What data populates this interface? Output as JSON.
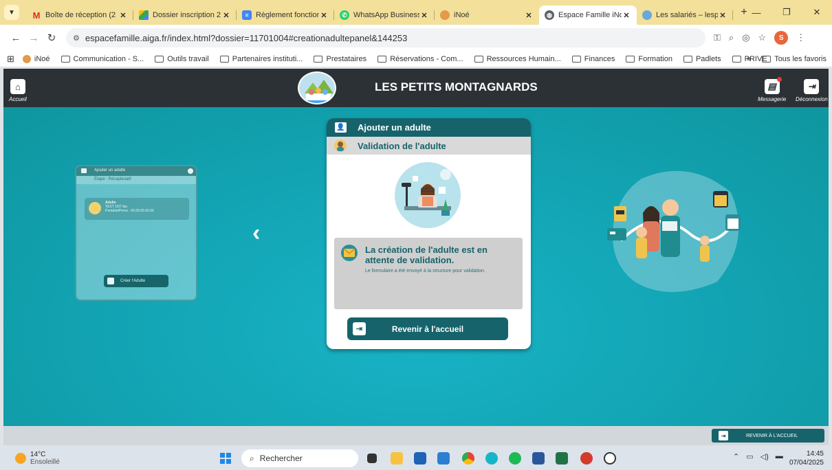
{
  "browser": {
    "tabs": [
      {
        "label": "Boîte de réception (2",
        "icon": "gmail-icon",
        "color": "#d93025",
        "active": false
      },
      {
        "label": "Dossier inscription 2",
        "icon": "drive-icon",
        "color": "#1e8e3e",
        "active": false
      },
      {
        "label": "Règlement fonction",
        "icon": "docs-icon",
        "color": "#4285f4",
        "active": false
      },
      {
        "label": "WhatsApp Business",
        "icon": "whatsapp-icon",
        "color": "#25d366",
        "active": false
      },
      {
        "label": "iNoé",
        "icon": "inoe-icon",
        "color": "#e39a4a",
        "active": false
      },
      {
        "label": "Espace Famille iNoe",
        "icon": "globe-icon",
        "color": "#5f6368",
        "active": true
      },
      {
        "label": "Les salariés – lespeti",
        "icon": "site-icon",
        "color": "#6aa9d8",
        "active": false
      }
    ],
    "url": "espacefamille.aiga.fr/index.html?dossier=11701004#creationadultepanel&144253",
    "bookmarks": [
      "iNoé",
      "Communication - S...",
      "Outils travail",
      "Partenaires instituti...",
      "Prestataires",
      "Réservations - Com...",
      "Ressources Humain...",
      "Finances",
      "Formation",
      "Padlets",
      "PRIVE"
    ],
    "all_favorites": "Tous les favoris",
    "profile_initial": "S"
  },
  "header": {
    "title": "LES PETITS MONTAGNARDS",
    "home_label": "Accueil",
    "messages_label": "Messagerie",
    "logout_label": "Déconnexion"
  },
  "ghost_card": {
    "title": "Ajouter un adulte",
    "step": "Étape : Récapitulatif",
    "item_name": "Adulte",
    "item_line1": "TEST 1/07 fas",
    "item_line2": "Portable/Perso : 00.00.00.00.00",
    "button": "Créer l'Adulte"
  },
  "card": {
    "title": "Ajouter un adulte",
    "step": "Validation de l'adulte",
    "message_title": "La création de l'adulte est en attente de validation.",
    "message_sub": "Le formulaire a été envoyé à la structure pour validation.",
    "back_button": "Revenir à l'accueil"
  },
  "bottom": {
    "back_button": "REVENIR À L'ACCUEIL"
  },
  "taskbar": {
    "temperature": "14°C",
    "weather": "Ensoleillé",
    "search_placeholder": "Rechercher",
    "time": "14:45",
    "date": "07/04/2025"
  },
  "colors": {
    "accent": "#16636b",
    "teal_bg": "#12a3b2",
    "header_bg": "#2c3136"
  }
}
